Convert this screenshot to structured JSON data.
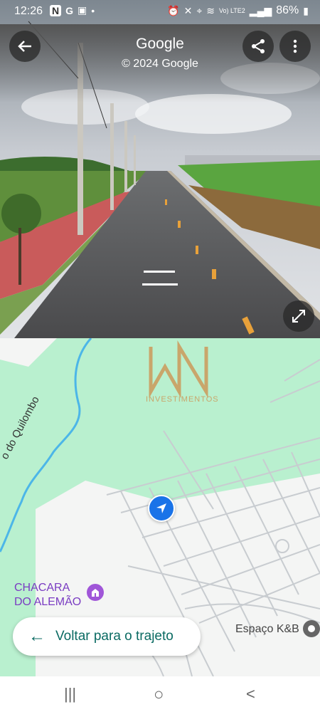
{
  "status": {
    "time": "12:26",
    "battery": "86%",
    "network": "Vo) LTE2",
    "left_icons": [
      "n-app-icon",
      "google-icon",
      "gallery-icon",
      "dot-icon"
    ],
    "right_icons": [
      "alarm-icon",
      "mute-icon",
      "location-icon",
      "wifi-icon",
      "signal-icon",
      "battery-icon"
    ]
  },
  "streetview": {
    "title": "Google",
    "copyright": "© 2024 Google"
  },
  "map": {
    "watermark": "INVESTIMENTOS",
    "river_label": "o do Quilombo",
    "poi_label": "CHACARA\nDO ALEMÃO",
    "place_label": "Espaço K&B",
    "back_button": "Voltar para o trajeto",
    "colors": {
      "park": "#b9f0cf",
      "accent": "#0b6b63",
      "poi": "#7a3cc2",
      "water": "#4cb6e8"
    }
  },
  "navbar": {
    "recents": "|||",
    "home": "○",
    "back": "<"
  }
}
